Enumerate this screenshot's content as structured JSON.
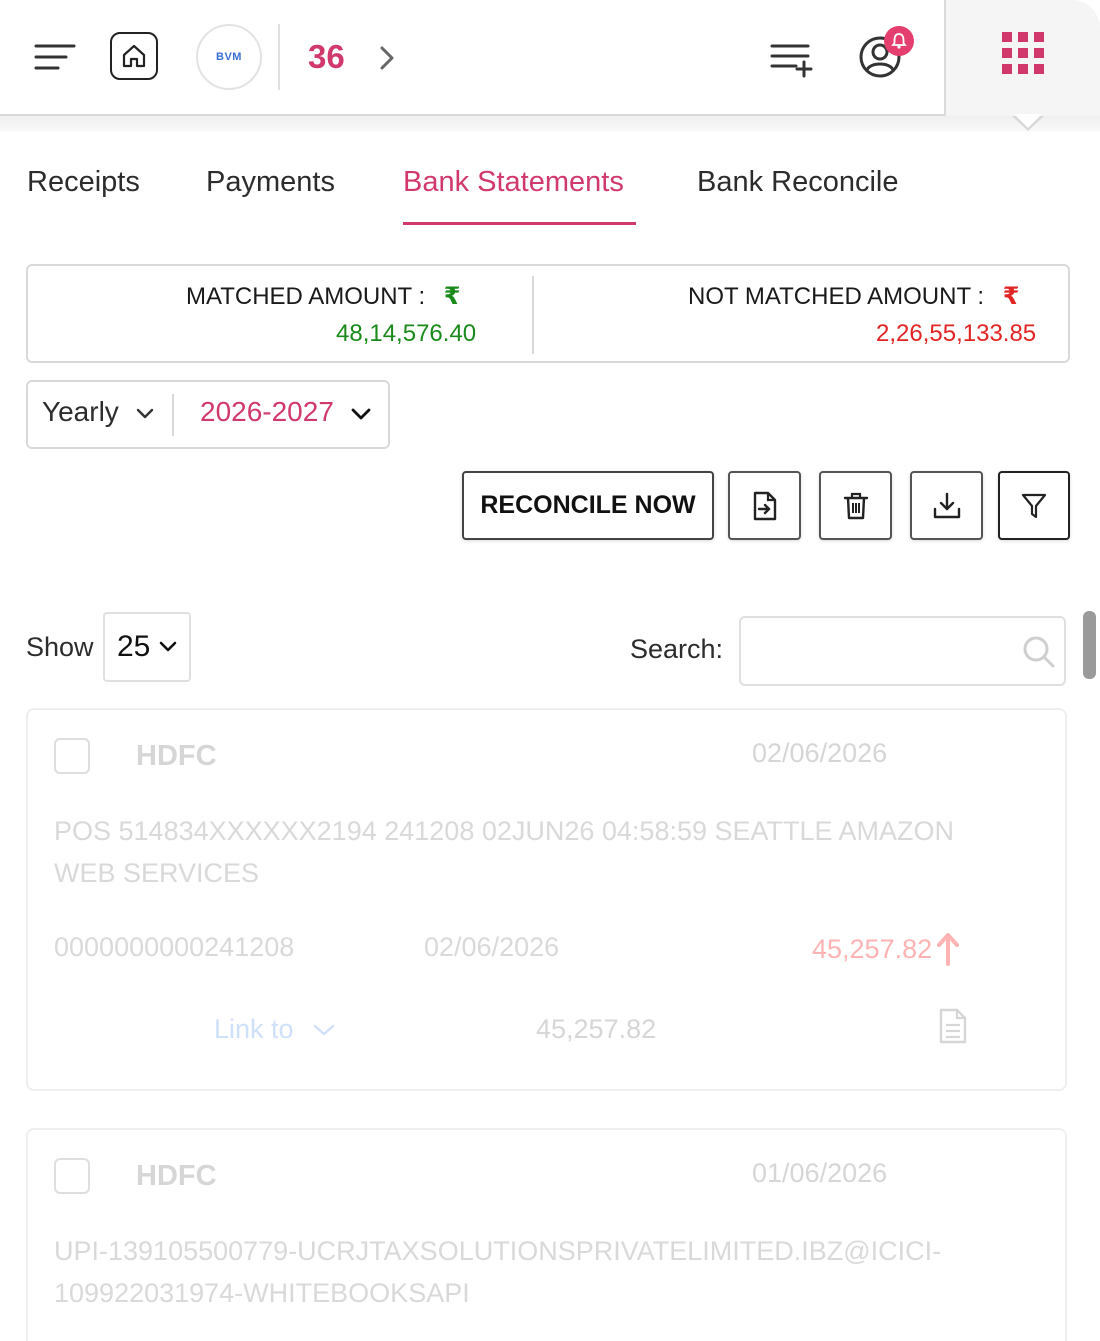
{
  "header": {
    "logo_text": "BVM",
    "count": "36",
    "icons": [
      "hamburger-icon",
      "home-icon",
      "chevron-right-icon",
      "add-list-icon",
      "user-icon",
      "bell-icon",
      "apps-grid-icon"
    ],
    "accent_color": "#d1386b"
  },
  "tabs": [
    {
      "label": "Receipts",
      "active": false
    },
    {
      "label": "Payments",
      "active": false
    },
    {
      "label": "Bank Statements",
      "active": true
    },
    {
      "label": "Bank Reconcile",
      "active": false
    }
  ],
  "summary": {
    "matched_label": "MATCHED AMOUNT :",
    "matched_currency": "₹",
    "matched_value": "48,14,576.40",
    "not_matched_label": "NOT MATCHED AMOUNT :",
    "not_matched_currency": "₹",
    "not_matched_value": "2,26,55,133.85",
    "matched_color": "#1a8a1a",
    "not_matched_color": "#e12424"
  },
  "period": {
    "type": "Yearly",
    "year": "2026-2027"
  },
  "actions": {
    "reconcile_label": "RECONCILE NOW",
    "icons": [
      "import-file-icon",
      "trash-icon",
      "download-icon",
      "filter-icon"
    ]
  },
  "table_controls": {
    "show_label": "Show",
    "page_size": "25",
    "search_label": "Search:",
    "search_value": "",
    "search_placeholder": ""
  },
  "transactions": [
    {
      "bank": "HDFC",
      "date": "02/06/2026",
      "narration": "POS 514834XXXXXX2194 241208 02JUN26 04:58:59 SEATTLE AMAZON WEB SERVICES",
      "reference": "0000000000241208",
      "value_date": "02/06/2026",
      "amount": "45,257.82",
      "direction": "debit",
      "link_label": "Link to",
      "link_amount": "45,257.82"
    },
    {
      "bank": "HDFC",
      "date": "01/06/2026",
      "narration": "UPI-139105500779-UCRJTAXSOLUTIONSPRIVATELIMITED.IBZ@ICICI-109922031974-WHITEBOOKSAPI"
    }
  ]
}
